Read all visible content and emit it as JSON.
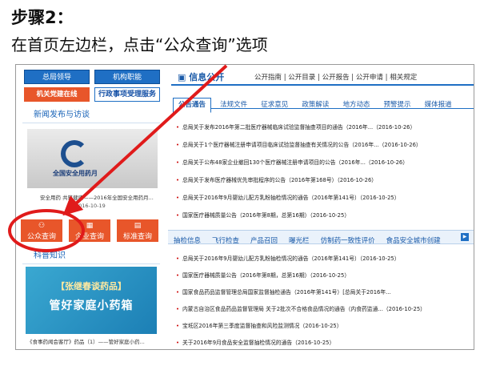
{
  "step": {
    "title": "步骤2：",
    "description": "在首页左边栏，点击“公众查询”选项"
  },
  "left": {
    "top_buttons": [
      "总局领导",
      "机构职能",
      "机关党建在线",
      "行政事项受理服务"
    ],
    "news_header": "新闻发布与访谈",
    "news_image_logo_text": "全国安全用药月",
    "news_caption": "安全用药 共筑健康——2016年全国安全用药月...",
    "news_date": "2016-10-19",
    "services": [
      "公众查询",
      "企业查询",
      "标准查询"
    ],
    "science_header": "科普知识",
    "promo_line1": "【张继春谈药品】",
    "promo_line2": "管好家庭小药箱",
    "promo_caption": "《食事药闻会客厅》药品（1）——管好家庭小药..."
  },
  "right": {
    "title": "信息公开",
    "links": [
      "公开指南",
      "公开目录",
      "公开报告",
      "公开申请",
      "相关规定"
    ],
    "tabs": [
      "公告通告",
      "法规文件",
      "征求意见",
      "政策解读",
      "地方动态",
      "预警提示",
      "媒体报道"
    ],
    "items": [
      "总局关于发布2016年第二批医疗器械临床试验监督抽查项目的通告（2016年...（2016-10-26）",
      "总局关于1个医疗器械注册申请项目临床试验监督抽查有关情况的公告（2016年...（2016-10-26）",
      "总局关于公布48家企业撤回130个医疗器械注册申请项目的公告（2016年...（2016-10-26）",
      "总局关于发布医疗器械优先审批程序的公告（2016年第168号）（2016-10-26）",
      "总局关于2016年9月婴幼儿配方乳粉抽检情况的通告（2016年第141号）（2016-10-25）",
      "国家医疗器械质量公告（2016年第8期，总第16期）（2016-10-25）"
    ],
    "bar2": [
      "抽检信息",
      "飞行检查",
      "产品召回",
      "曝光栏",
      "仿制药一致性评价",
      "食品安全城市创建"
    ],
    "items2": [
      "总局关于2016年9月婴幼儿配方乳粉抽检情况的通告（2016年第141号）（2016-10-25）",
      "国家医疗器械质量公告（2016年第8期，总第16期）（2016-10-25）",
      "国家食品药品监督管理总局国家监督抽检通告（2016年第141号）[总局关于2016年...",
      "内蒙古自治区食品药品监督管理局 关于2批次不合格食品情况的通告（内食药监通...（2016-10-25）",
      "宝坻区2016年第三季度监督抽查和风险监测情况（2016-10-25）",
      "关于2016年9月食品安全监督抽检情况的通告（2016-10-25）"
    ]
  },
  "colors": {
    "accent_blue": "#1f6fc4",
    "service_orange": "#e8562a",
    "highlight_red": "#e01b1b"
  }
}
